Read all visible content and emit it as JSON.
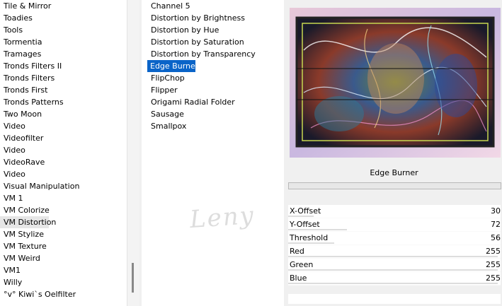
{
  "category_list": {
    "items": [
      "Tile & Mirror",
      "Toadies",
      "Tools",
      "Tormentia",
      "Tramages",
      "Tronds Filters II",
      "Tronds Filters",
      "Tronds First",
      "Tronds Patterns",
      "Two Moon",
      "Video",
      "Videofilter",
      "Video",
      "VideoRave",
      "Video",
      "Visual Manipulation",
      "VM 1",
      "VM Colorize",
      "VM Distortion",
      "VM Stylize",
      "VM Texture",
      "VM Weird",
      "VM1",
      "Willy",
      "°v° Kiwi`s Oelfilter"
    ],
    "selected_index": 18
  },
  "filter_list": {
    "items": [
      "Channel 5",
      "Distortion by Brightness",
      "Distortion by Hue",
      "Distortion by Saturation",
      "Distortion by Transparency",
      "Edge Burner",
      "FlipChop",
      "Flipper",
      "Origami Radial Folder",
      "Sausage",
      "Smallpox"
    ],
    "selected_index": 5
  },
  "watermark_text": "Leny",
  "filter_title": "Edge Burner",
  "parameters": [
    {
      "name": "X-Offset",
      "value": "30",
      "level": 0.12
    },
    {
      "name": "Y-Offset",
      "value": "72",
      "level": 0.28
    },
    {
      "name": "Threshold",
      "value": "56",
      "level": 0.22
    },
    {
      "name": "Red",
      "value": "255",
      "level": 1.0
    },
    {
      "name": "Green",
      "value": "255",
      "level": 1.0
    },
    {
      "name": "Blue",
      "value": "255",
      "level": 1.0
    }
  ],
  "colors": {
    "selection": "#0a64c8",
    "panel_bg": "#ffffff",
    "window_bg": "#f0f0f0"
  }
}
